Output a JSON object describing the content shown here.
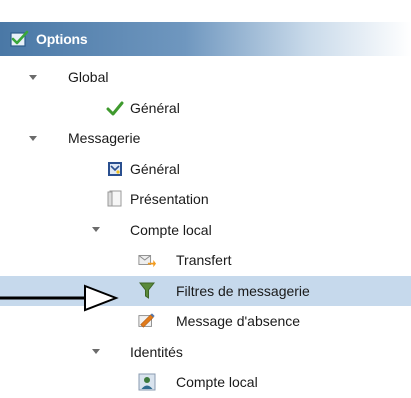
{
  "header": {
    "title": "Options",
    "icon": "checked-box-icon"
  },
  "tree": {
    "global": {
      "label": "Global"
    },
    "global_general": {
      "label": "Général",
      "icon": "green-check-icon"
    },
    "messagerie": {
      "label": "Messagerie"
    },
    "messagerie_general": {
      "label": "Général",
      "icon": "general-settings-icon"
    },
    "presentation": {
      "label": "Présentation",
      "icon": "page-icon"
    },
    "compte_local": {
      "label": "Compte local"
    },
    "transfert": {
      "label": "Transfert",
      "icon": "forward-mail-icon"
    },
    "filtres": {
      "label": "Filtres de messagerie",
      "icon": "filter-icon",
      "selected": true
    },
    "absence": {
      "label": "Message d'absence",
      "icon": "away-message-icon"
    },
    "identites": {
      "label": "Identités"
    },
    "identites_compte_local": {
      "label": "Compte local",
      "icon": "user-account-icon"
    }
  },
  "annotation": {
    "icon": "pointer-arrow-icon"
  },
  "colors": {
    "header_start": "#4a78a6",
    "selected_row": "#c6d9ec",
    "filter_green": "#5a8a3a"
  }
}
